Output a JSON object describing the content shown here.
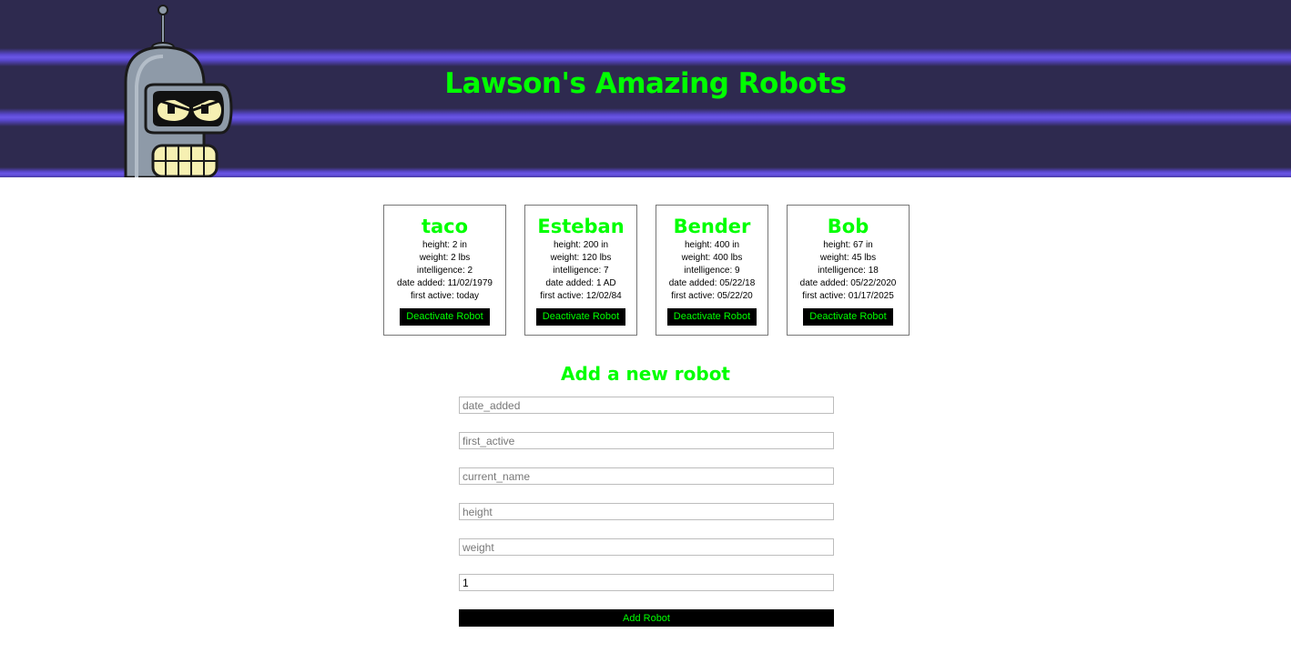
{
  "header": {
    "title": "Lawson's Amazing Robots",
    "logo_icon": "robot-head-icon",
    "colors": {
      "background": "#2e2a4f",
      "stripe": "#5a48d0",
      "accent": "#00ff00"
    }
  },
  "robots": [
    {
      "name": "taco",
      "height": "height: 2 in",
      "weight": "weight: 2 lbs",
      "intelligence": "intelligence: 2",
      "date_added": "date added: 11/02/1979",
      "first_active": "first active: today",
      "button": "Deactivate Robot"
    },
    {
      "name": "Esteban",
      "height": "height: 200 in",
      "weight": "weight: 120 lbs",
      "intelligence": "intelligence: 7",
      "date_added": "date added: 1 AD",
      "first_active": "first active: 12/02/84",
      "button": "Deactivate Robot"
    },
    {
      "name": "Bender",
      "height": "height: 400 in",
      "weight": "weight: 400 lbs",
      "intelligence": "intelligence: 9",
      "date_added": "date added: 05/22/18",
      "first_active": "first active: 05/22/20",
      "button": "Deactivate Robot"
    },
    {
      "name": "Bob",
      "height": "height: 67 in",
      "weight": "weight: 45 lbs",
      "intelligence": "intelligence: 18",
      "date_added": "date added: 05/22/2020",
      "first_active": "first active: 01/17/2025",
      "button": "Deactivate Robot"
    }
  ],
  "form": {
    "title": "Add a new robot",
    "fields": [
      {
        "placeholder": "date_added",
        "value": ""
      },
      {
        "placeholder": "first_active",
        "value": ""
      },
      {
        "placeholder": "current_name",
        "value": ""
      },
      {
        "placeholder": "height",
        "value": ""
      },
      {
        "placeholder": "weight",
        "value": ""
      },
      {
        "placeholder": "",
        "value": "1"
      }
    ],
    "submit_label": "Add Robot"
  }
}
